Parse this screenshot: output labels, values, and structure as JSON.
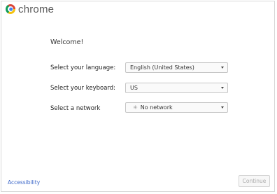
{
  "brand": {
    "logo_text": "chrome"
  },
  "main": {
    "welcome": "Welcome!",
    "language": {
      "label": "Select your language:",
      "value": "English (United States)"
    },
    "keyboard": {
      "label": "Select your keyboard:",
      "value": "US"
    },
    "network": {
      "label": "Select a network",
      "value": "No network"
    }
  },
  "footer": {
    "accessibility": "Accessibility",
    "continue": "Continue"
  },
  "icons": {
    "logo": "chrome-logo-icon",
    "dropdown": "chevron-down-icon",
    "network": "wifi-off-icon"
  },
  "colors": {
    "link": "#3a66c8",
    "disabled_text": "#aaaaaa"
  }
}
